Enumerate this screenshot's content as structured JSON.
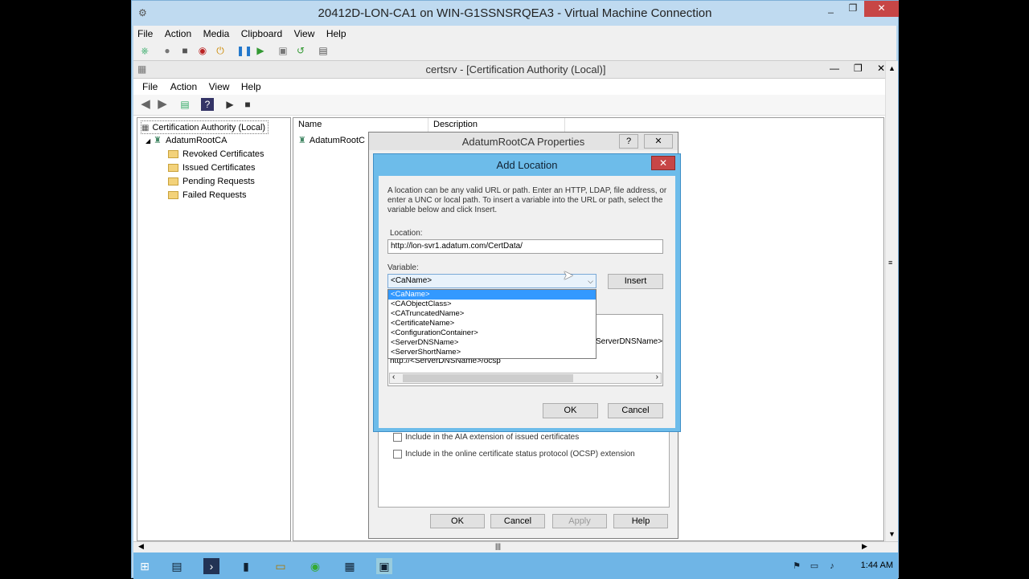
{
  "vm": {
    "title": "20412D-LON-CA1 on WIN-G1SSNSRQEA3 - Virtual Machine Connection",
    "menu": [
      "File",
      "Action",
      "Media",
      "Clipboard",
      "View",
      "Help"
    ],
    "controls": {
      "min": "_",
      "max": "❐",
      "close": "✕"
    }
  },
  "mmc": {
    "title": "certsrv - [Certification Authority (Local)]",
    "menu": [
      "File",
      "Action",
      "View",
      "Help"
    ],
    "tree": {
      "root": "Certification Authority (Local)",
      "ca": "AdatumRootCA",
      "children": [
        "Revoked Certificates",
        "Issued Certificates",
        "Pending Requests",
        "Failed Requests"
      ]
    },
    "columns": {
      "name": "Name",
      "description": "Description"
    },
    "row_name": "AdatumRootC"
  },
  "props_dialog": {
    "title": "AdatumRootCA Properties",
    "help_btn": "?",
    "close_btn": "✕",
    "checks": [
      "Include in the AIA extension of issued certificates",
      "Include in the online certificate status protocol (OCSP) extension"
    ],
    "buttons": {
      "ok": "OK",
      "cancel": "Cancel",
      "apply": "Apply",
      "help": "Help"
    }
  },
  "add_location": {
    "title": "Add Location",
    "close": "✕",
    "description": "A location can be any valid URL or path. Enter an HTTP, LDAP, file address, or enter a UNC or local path. To insert a variable into the URL or path, select the variable below and click Insert.",
    "location_label": "Location:",
    "location_value": "http://lon-svr1.adatum.com/CertData/",
    "variable_label": "Variable:",
    "variable_selected": "<CaName>",
    "insert_label": "Insert",
    "variable_options": [
      "<CaName>",
      "<CAObjectClass>",
      "<CATruncatedName>",
      "<CertificateName>",
      "<ConfigurationContainer>",
      "<ServerDNSName>",
      "<ServerShortName>"
    ],
    "url_fragment_1": "ServerDNSName>",
    "url_fragment_2": "http://<ServerDNSName>/ocsp",
    "ok_label": "OK",
    "cancel_label": "Cancel"
  },
  "taskbar": {
    "clock": "1:44 AM"
  }
}
